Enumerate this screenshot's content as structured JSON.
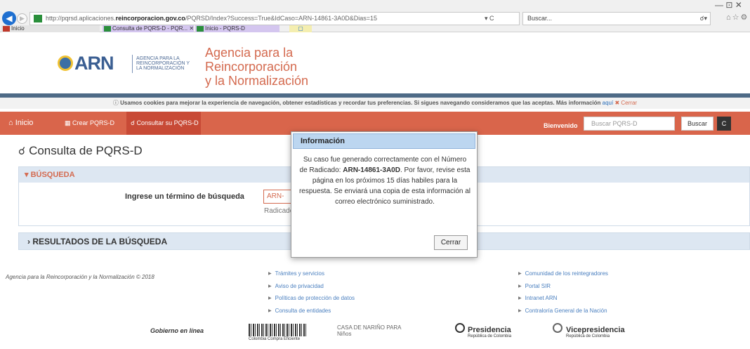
{
  "browser": {
    "url_prefix": "http://pqrsd.aplicaciones.",
    "url_domain": "reincorporacion.gov.co",
    "url_path": "/PQRSD/Index?Success=True&IdCaso=ARN-14861-3A0D&Dias=15",
    "url_tail": "▾ C",
    "search_placeholder": "Buscar...",
    "tabs": [
      {
        "label": "Inicio"
      },
      {
        "label": "Consulta de PQRS-D - PQR...  ✕"
      },
      {
        "label": "Inicio - PQRS-D"
      }
    ],
    "window_controls": "— ⊡ ✕"
  },
  "header": {
    "logo_text": "ARN",
    "logo_sub": "AGENCIA PARA LA REINCORPORACIÓN Y LA NORMALIZACIÓN",
    "agency_line1": "Agencia para la",
    "agency_line2": "Reincorporación",
    "agency_line3": "y la Normalización"
  },
  "cookie": {
    "text": "Usamos cookies para mejorar la experiencia de navegación, obtener estadísticas y recordar tus preferencias. Si sigues navegando consideramos que las aceptas. Más información",
    "link": "aquí",
    "close": "Cerrar"
  },
  "menu": {
    "home": "Inicio",
    "crear": "Crear PQRS-D",
    "consultar": "Consultar su PQRS-D",
    "bienvenido": "Bienvenido",
    "search_placeholder": "Buscar PQRS-D",
    "search_button": "Buscar",
    "extra_button": "C"
  },
  "page": {
    "title": "Consulta de PQRS-D",
    "busqueda_header": "BÚSQUEDA",
    "field_label": "Ingrese un término de búsqueda",
    "field_value": "ARN-",
    "field_help": "Radicado",
    "results_header": "RESULTADOS DE LA BÚSQUEDA"
  },
  "modal": {
    "title": "Información",
    "text_before": "Su caso fue generado correctamente con el Número de Radicado:",
    "radicado": "ARN-14861-3A0D",
    "text_after": ". Por favor, revise esta página en los próximos 15 días habiles para la respuesta. Se enviará una copia de esta información al correo electrónico suministrado.",
    "close_button": "Cerrar"
  },
  "footer": {
    "copyright": "Agencia para la Reincorporación y la Normalización © 2018",
    "links_col1": [
      "Trámites y servicios",
      "Aviso de privacidad",
      "Políticas de protección de datos",
      "Consulta de entidades"
    ],
    "links_col2": [
      "Comunidad de los reintegradores",
      "Portal SIR",
      "Intranet ARN",
      "Contraloría General de la Nación"
    ],
    "logos": [
      "Gobierno en línea",
      "Colombia Compra Eficiente",
      "CASA DE NARIÑO PARA Niños",
      "Presidencia",
      "República de Colombia",
      "Vicepresidencia",
      "República de Colombia"
    ]
  }
}
